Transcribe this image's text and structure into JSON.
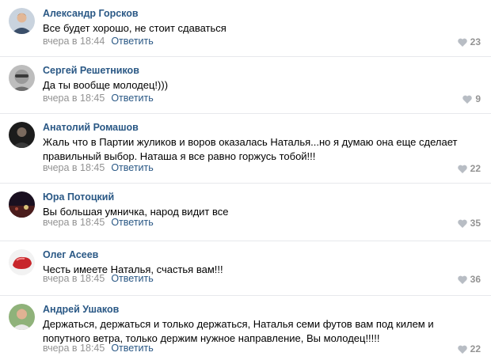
{
  "comments": [
    {
      "author": "Александр Горсков",
      "text": [
        "Все будет хорошо, не стоит сдаваться"
      ],
      "time": "вчера в 18:44",
      "reply": "Ответить",
      "likes": "23",
      "avatar_color": "#3b4f6a"
    },
    {
      "author": "Сергей Решетников",
      "text": [
        "Да ты вообще молодец!)))"
      ],
      "time": "вчера в 18:45",
      "reply": "Ответить",
      "likes": "9",
      "avatar_color": "#8a8a8a"
    },
    {
      "author": "Анатолий Ромашов",
      "text": [
        "Жаль что в Партии жуликов и воров оказалась Наталья...но я думаю она еще сделает",
        "правильный выбор. Наташа я все равно горжусь тобой!!!"
      ],
      "time": "вчера в 18:45",
      "reply": "Ответить",
      "likes": "22",
      "avatar_color": "#2b2b2b"
    },
    {
      "author": "Юра Потоцкий",
      "text": [
        "Вы большая умничка, народ видит все"
      ],
      "time": "вчера в 18:45",
      "reply": "Ответить",
      "likes": "35",
      "avatar_color": "#3a1f1f"
    },
    {
      "author": "Олег Асеев",
      "text": [
        "Честь имеете Наталья, счастья вам!!!"
      ],
      "time": "вчера в 18:45",
      "reply": "Ответить",
      "likes": "36",
      "avatar_color": "#c8262b"
    },
    {
      "author": "Андрей Ушаков",
      "text": [
        "Держаться, держаться и только держаться, Наталья семи футов вам под килем и",
        "попутного ветра, только держим нужное направление, Вы молодец!!!!!"
      ],
      "time": "вчера в 18:45",
      "reply": "Ответить",
      "likes": "22",
      "avatar_color": "#6b8e5a"
    }
  ],
  "colors": {
    "link": "#2a5885",
    "muted": "#939393",
    "divider": "#e7e8ec"
  },
  "icons": {
    "like": "heart-icon"
  }
}
